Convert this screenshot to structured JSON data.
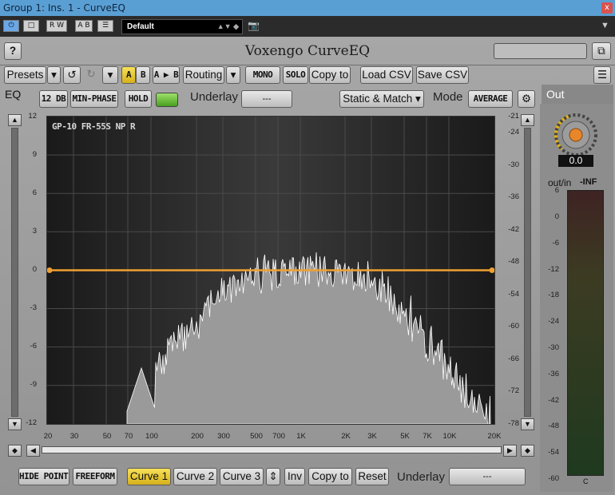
{
  "window": {
    "title": "Group 1: Ins. 1 - CurveEQ",
    "close": "x"
  },
  "host": {
    "buttons": [
      "⏻",
      "□",
      "R W",
      "A B",
      "☰"
    ],
    "preset": "Default",
    "preset_arrows": "▲▼ ◆",
    "camera": "📷",
    "menu": "▼"
  },
  "plugin": {
    "brand": "Voxengo CurveEQ",
    "help": "?",
    "toolbar1": {
      "presets": "Presets",
      "routing": "Routing",
      "mono": "MONO",
      "solo": "SOLO",
      "copy_to": "Copy to",
      "load_csv": "Load CSV",
      "save_csv": "Save CSV",
      "a": "A",
      "b": "B",
      "ab": "A ▶ B"
    },
    "tab_eq": "EQ",
    "tab_out": "Out",
    "toolbar2": {
      "range": "12 DB",
      "phase": "MIN-PHASE",
      "hold": "HOLD",
      "underlay_label": "Underlay",
      "underlay_value": "---",
      "static_match": "Static & Match ▾",
      "mode_label": "Mode",
      "mode_value": "AVERAGE"
    },
    "graph_label": "GP-10 FR-55S NP R",
    "left_ticks": [
      "12",
      "9",
      "6",
      "3",
      "0",
      "-3",
      "-6",
      "-9",
      "-12"
    ],
    "right_ticks": [
      "-21",
      "-24",
      "-30",
      "-36",
      "-42",
      "-48",
      "-54",
      "-60",
      "-66",
      "-72",
      "-78"
    ],
    "x_ticks": [
      "20",
      "30",
      "50",
      "70",
      "100",
      "200",
      "300",
      "500",
      "700",
      "1K",
      "2K",
      "3K",
      "5K",
      "7K",
      "10K",
      "20K"
    ],
    "bottom": {
      "hide_points": "HIDE POINTS",
      "freeform": "FREEFORM",
      "curve1": "Curve 1",
      "curve2": "Curve 2",
      "curve3": "Curve 3",
      "inv": "Inv",
      "copy_to": "Copy to",
      "reset": "Reset",
      "underlay_label": "Underlay",
      "underlay_value": "---"
    },
    "out": {
      "value": "0.0",
      "outin": "out/in",
      "inf": "-INF",
      "channel": "C",
      "meter_ticks": [
        "6",
        "0",
        "-6",
        "-12",
        "-18",
        "-24",
        "-30",
        "-36",
        "-42",
        "-48",
        "-54",
        "-60"
      ]
    }
  }
}
